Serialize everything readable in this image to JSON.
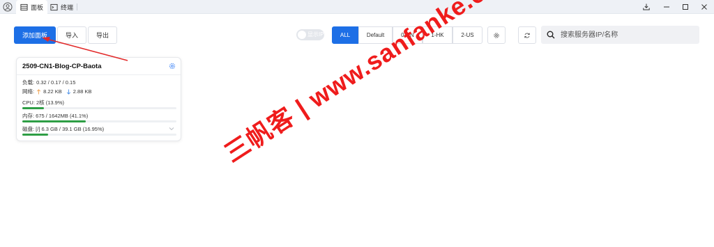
{
  "titlebar": {
    "tabs": [
      {
        "label": "面板",
        "icon": "panel-icon",
        "active": true
      },
      {
        "label": "终端",
        "icon": "terminal-icon",
        "active": false
      }
    ],
    "window_controls": [
      "download-icon",
      "minimize-icon",
      "maximize-icon",
      "close-icon"
    ]
  },
  "toolbar": {
    "add_panel_label": "添加面板",
    "import_label": "导入",
    "export_label": "导出",
    "ip_toggle_label": "显示IP",
    "ip_toggle_on": false,
    "filters": [
      "ALL",
      "Default",
      "0-CN",
      "1-HK",
      "2-US"
    ],
    "active_filter": "ALL",
    "search": {
      "placeholder": "搜索服务器IP/名称",
      "value": ""
    }
  },
  "server_card": {
    "name": "2509-CN1-Blog-CP-Baota",
    "load_label": "负载:",
    "load_value": "0.32 / 0.17 / 0.15",
    "network_label": "网络:",
    "upload_value": "8.22 KB",
    "download_value": "2.88 KB",
    "cpu_text": "CPU: 2核 (13.9%)",
    "cpu_percent": 13.9,
    "memory_text": "内存: 675 / 1642MB (41.1%)",
    "memory_percent": 41.1,
    "disk_text": "磁盘: [/] 6.3 GB / 39.1 GB (16.95%)",
    "disk_percent": 16.95
  },
  "annotation": {
    "watermark": "三帆客 | www.sanfanke.com",
    "color": "#ef1c1c"
  },
  "colors": {
    "primary": "#1d6fe6",
    "usage_bar": "#2e9e45",
    "titlebar_bg": "#eef1f6"
  }
}
